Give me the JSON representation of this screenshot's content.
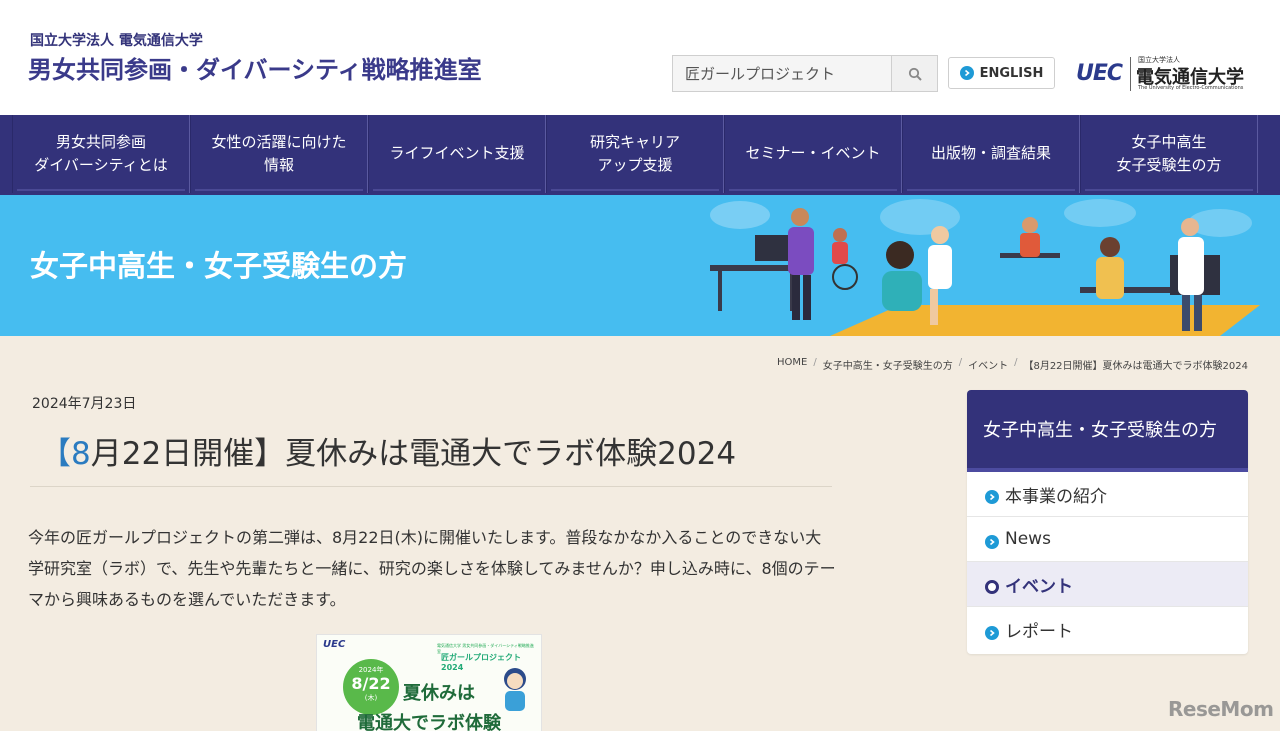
{
  "header": {
    "org_sub": "国立大学法人 電気通信大学",
    "org_main": "男女共同参画・ダイバーシティ戦略推進室",
    "search_value": "匠ガールプロジェクト",
    "english_label": "ENGLISH",
    "uec_mark": "UEC",
    "uec_small": "国立大学法人",
    "uec_name": "電気通信大学",
    "uec_en": "The University of Electro-Communications"
  },
  "nav": {
    "items": [
      {
        "label": "男女共同参画\nダイバーシティとは"
      },
      {
        "label": "女性の活躍に向けた\n情報"
      },
      {
        "label": "ライフイベント支援"
      },
      {
        "label": "研究キャリア\nアップ支援"
      },
      {
        "label": "セミナー・イベント"
      },
      {
        "label": "出版物・調査結果"
      },
      {
        "label": "女子中高生\n女子受験生の方"
      }
    ]
  },
  "hero": {
    "title": "女子中高生・女子受験生の方"
  },
  "breadcrumb": {
    "items": [
      "HOME",
      "女子中高生・女子受験生の方",
      "イベント",
      "【8月22日開催】夏休みは電通大でラボ体験2024"
    ]
  },
  "article": {
    "date": "2024年7月23日",
    "title_open": "【",
    "title_num": "8",
    "title_rest": "月22日開催】夏休みは電通大でラボ体験2024",
    "body": "今年の匠ガールプロジェクトの第二弾は、8月22日(木)に開催いたします。普段なかなか入ることのできない大学研究室（ラボ）で、先生や先輩たちと一緒に、研究の楽しさを体験してみませんか？申し込み時に、8個のテーマから興味あるものを選んでいただきます。",
    "poster": {
      "uec": "UEC",
      "top": "電気通信大学 男女共同参画・ダイバーシティ戦略推進室",
      "project": "匠ガールプロジェクト 2024",
      "badge_year": "2024年",
      "badge_date": "8/22",
      "badge_day": "(木)",
      "line1": "夏休みは",
      "line2": "電通大でラボ体験"
    }
  },
  "sidebar": {
    "heading": "女子中高生・女子受験生の方",
    "items": [
      {
        "label": "本事業の紹介",
        "active": false
      },
      {
        "label": "News",
        "active": false
      },
      {
        "label": "イベント",
        "active": true
      },
      {
        "label": "レポート",
        "active": false
      }
    ]
  },
  "watermark": "ReseMom",
  "colors": {
    "nav_bg": "#33327a",
    "hero_bg": "#46bdf0",
    "accent_blue": "#1e9ad6",
    "page_bg": "#f3ece1"
  }
}
